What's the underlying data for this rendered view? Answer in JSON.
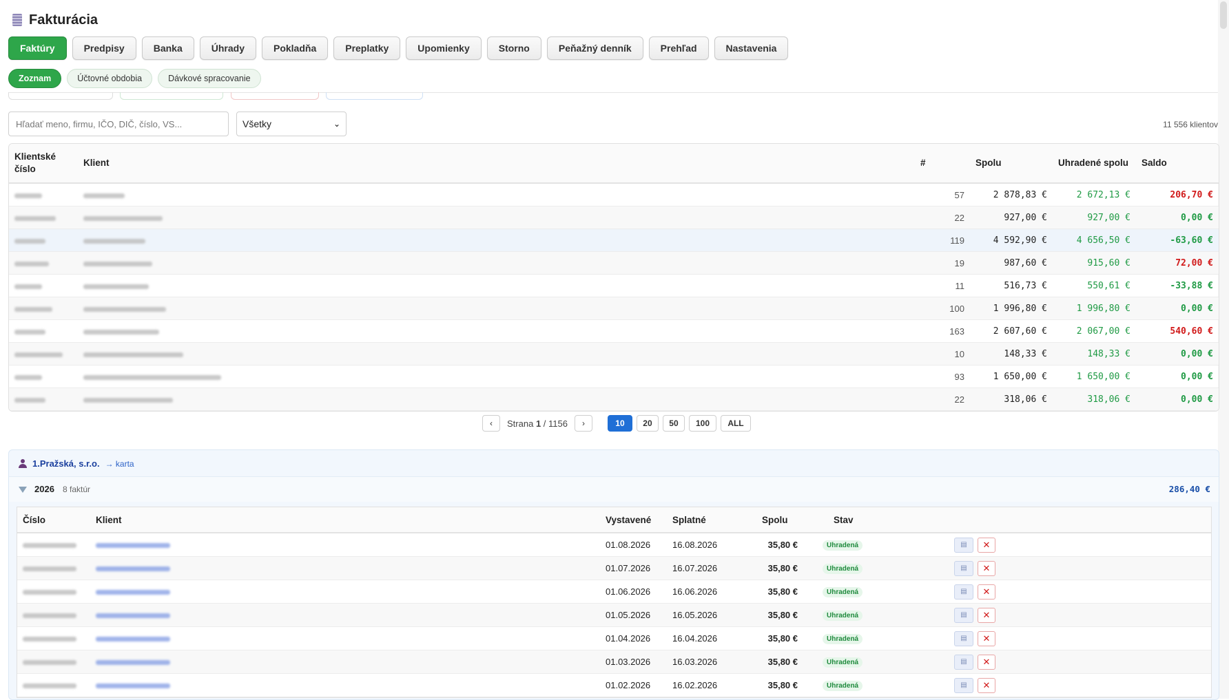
{
  "app": {
    "title": "Fakturácia",
    "logo_icon": "invoice-icon"
  },
  "tabs": [
    {
      "label": "Faktúry",
      "active": true
    },
    {
      "label": "Predpisy"
    },
    {
      "label": "Banka"
    },
    {
      "label": "Úhrady"
    },
    {
      "label": "Pokladňa"
    },
    {
      "label": "Preplatky"
    },
    {
      "label": "Upomienky"
    },
    {
      "label": "Storno"
    },
    {
      "label": "Peňažný denník"
    },
    {
      "label": "Prehľad"
    },
    {
      "label": "Nastavenia"
    }
  ],
  "subtabs": [
    {
      "label": "Zoznam",
      "active": true
    },
    {
      "label": "Účtovné obdobia"
    },
    {
      "label": "Dávkové spracovanie"
    }
  ],
  "search": {
    "placeholder": "Hľadať meno, firmu, IČO, DIČ, číslo, VS...",
    "value": ""
  },
  "filter": {
    "selected": "Všetky"
  },
  "client_count": "11 556 klientov",
  "clients_table": {
    "headers": {
      "client_number": "Klientské číslo",
      "client": "Klient",
      "count": "#",
      "total": "Spolu",
      "paid_total": "Uhradené spolu",
      "balance": "Saldo"
    },
    "rows": [
      {
        "count": "57",
        "total": "2 878,83 €",
        "paid": "2 672,13 €",
        "balance": "206,70 €",
        "balance_status": "debt"
      },
      {
        "count": "22",
        "total": "927,00 €",
        "paid": "927,00 €",
        "balance": "0,00 €",
        "balance_status": "ok"
      },
      {
        "count": "119",
        "total": "4 592,90 €",
        "paid": "4 656,50 €",
        "balance": "-63,60 €",
        "balance_status": "ok"
      },
      {
        "count": "19",
        "total": "987,60 €",
        "paid": "915,60 €",
        "balance": "72,00 €",
        "balance_status": "debt"
      },
      {
        "count": "11",
        "total": "516,73 €",
        "paid": "550,61 €",
        "balance": "-33,88 €",
        "balance_status": "ok"
      },
      {
        "count": "100",
        "total": "1 996,80 €",
        "paid": "1 996,80 €",
        "balance": "0,00 €",
        "balance_status": "ok"
      },
      {
        "count": "163",
        "total": "2 607,60 €",
        "paid": "2 067,00 €",
        "balance": "540,60 €",
        "balance_status": "debt"
      },
      {
        "count": "10",
        "total": "148,33 €",
        "paid": "148,33 €",
        "balance": "0,00 €",
        "balance_status": "ok"
      },
      {
        "count": "93",
        "total": "1 650,00 €",
        "paid": "1 650,00 €",
        "balance": "0,00 €",
        "balance_status": "ok"
      },
      {
        "count": "22",
        "total": "318,06 €",
        "paid": "318,06 €",
        "balance": "0,00 €",
        "balance_status": "ok"
      }
    ]
  },
  "pagination": {
    "prev": "‹",
    "next": "›",
    "label": "Strana",
    "current": "1",
    "total": "/ 1156",
    "page_sizes": [
      "10",
      "20",
      "50",
      "100",
      "ALL"
    ],
    "active_size": "10"
  },
  "detail": {
    "client_name": "1.Pražská, s.r.o.",
    "card_link": "→ karta",
    "year": "2026",
    "year_count": "8 faktúr",
    "year_total": "286,40 €",
    "invoice_headers": {
      "number": "Číslo",
      "client": "Klient",
      "issued": "Vystavené",
      "due": "Splatné",
      "total": "Spolu",
      "status": "Stav"
    },
    "invoices": [
      {
        "issued": "01.08.2026",
        "due": "16.08.2026",
        "total": "35,80 €",
        "status": "Uhradená"
      },
      {
        "issued": "01.07.2026",
        "due": "16.07.2026",
        "total": "35,80 €",
        "status": "Uhradená"
      },
      {
        "issued": "01.06.2026",
        "due": "16.06.2026",
        "total": "35,80 €",
        "status": "Uhradená"
      },
      {
        "issued": "01.05.2026",
        "due": "16.05.2026",
        "total": "35,80 €",
        "status": "Uhradená"
      },
      {
        "issued": "01.04.2026",
        "due": "16.04.2026",
        "total": "35,80 €",
        "status": "Uhradená"
      },
      {
        "issued": "01.03.2026",
        "due": "16.03.2026",
        "total": "35,80 €",
        "status": "Uhradená"
      },
      {
        "issued": "01.02.2026",
        "due": "16.02.2026",
        "total": "35,80 €",
        "status": "Uhradená"
      }
    ]
  },
  "colors": {
    "accent_green": "#2ea64a",
    "paid_green": "#1f9a44",
    "debt_red": "#d11a1a",
    "page_active_blue": "#1f6fd6",
    "client_link_blue": "#1a3f9e"
  }
}
